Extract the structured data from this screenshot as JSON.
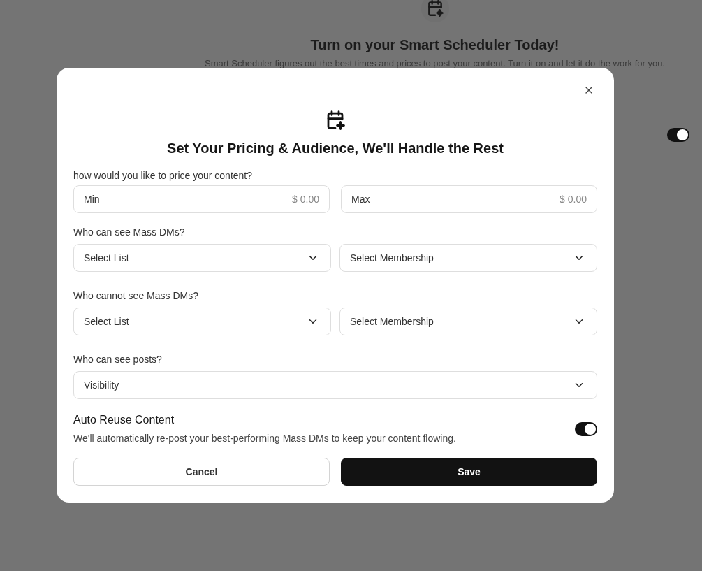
{
  "background": {
    "title": "Turn on your Smart Scheduler Today!",
    "subtitle": "Smart Scheduler figures out the best times and prices to post your content. Turn it on and let it do the work for you.",
    "toggle": {
      "on": true
    }
  },
  "dialog": {
    "title": "Set Your Pricing & Audience, We'll Handle the Rest",
    "price": {
      "label": "how would you like to price your content?",
      "fields": [
        {
          "label": "Min",
          "placeholder": "$ 0.00"
        },
        {
          "label": "Max",
          "placeholder": "$ 0.00"
        }
      ]
    },
    "sections": [
      {
        "label": "Who can see Mass DMs?",
        "selects": [
          "Select List",
          "Select Membership"
        ]
      },
      {
        "label": "Who cannot see Mass DMs?",
        "selects": [
          "Select List",
          "Select Membership"
        ]
      },
      {
        "label": "Who can see posts?",
        "selects": [
          "Visibility"
        ]
      }
    ],
    "auto_reuse": {
      "title": "Auto Reuse Content",
      "description": "We'll automatically re-post your best-performing Mass DMs to keep your content flowing.",
      "on": true
    },
    "buttons": [
      {
        "label": "Cancel",
        "kind": "secondary"
      },
      {
        "label": "Save",
        "kind": "primary"
      }
    ]
  }
}
